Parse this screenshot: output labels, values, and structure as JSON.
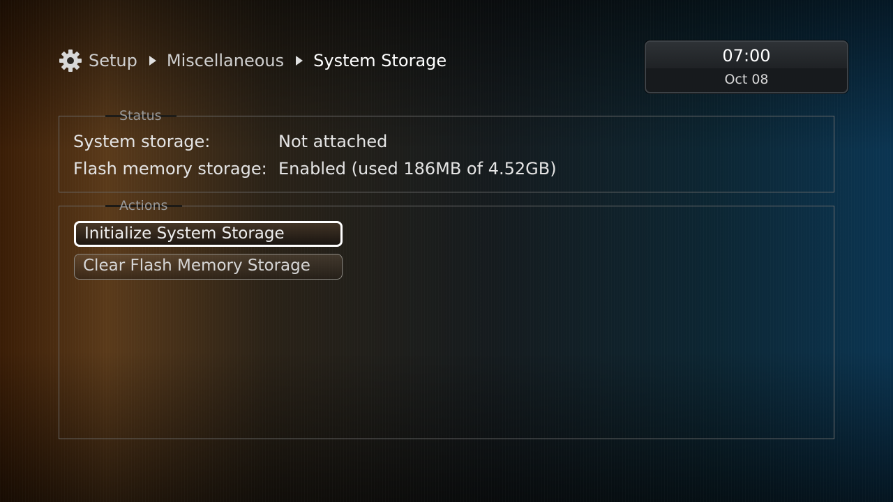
{
  "breadcrumb": {
    "icon": "gear-icon",
    "items": [
      "Setup",
      "Miscellaneous",
      "System Storage"
    ]
  },
  "clock": {
    "time": "07:00",
    "date": "Oct 08"
  },
  "status": {
    "title": "Status",
    "rows": [
      {
        "label": "System storage:",
        "value": "Not attached"
      },
      {
        "label": "Flash memory storage:",
        "value": "Enabled (used 186MB of 4.52GB)"
      }
    ]
  },
  "actions": {
    "title": "Actions",
    "buttons": [
      {
        "label": "Initialize System Storage",
        "focused": true
      },
      {
        "label": "Clear Flash Memory Storage",
        "focused": false
      }
    ]
  },
  "colors": {
    "accent_focus": "#ffffff",
    "text": "#e6e6e6",
    "panel_border": "#6a6a6a"
  }
}
